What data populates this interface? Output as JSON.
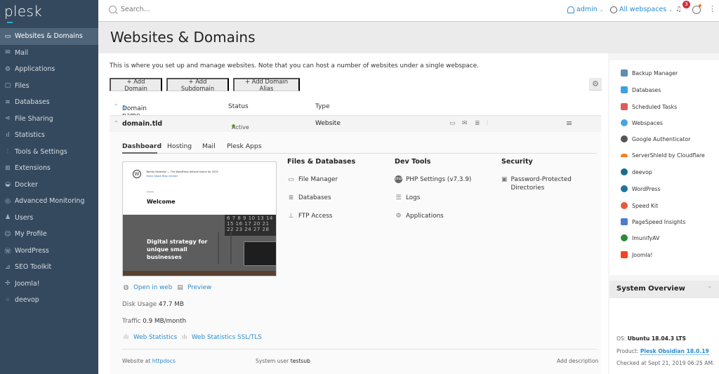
{
  "app": {
    "logo": "plesk"
  },
  "sidebar": {
    "items": [
      {
        "label": "Websites & Domains",
        "icon": "monitor-icon",
        "active": true
      },
      {
        "label": "Mail",
        "icon": "mail-icon"
      },
      {
        "label": "Applications",
        "icon": "gear-icon"
      },
      {
        "label": "Files",
        "icon": "folder-icon"
      },
      {
        "label": "Databases",
        "icon": "database-icon"
      },
      {
        "label": "File Sharing",
        "icon": "share-icon"
      },
      {
        "label": "Statistics",
        "icon": "bar-chart-icon"
      },
      {
        "label": "Tools & Settings",
        "icon": "sliders-icon"
      },
      {
        "label": "Extensions",
        "icon": "extensions-icon"
      },
      {
        "label": "Docker",
        "icon": "docker-icon"
      },
      {
        "label": "Advanced Monitoring",
        "icon": "monitoring-icon"
      },
      {
        "label": "Users",
        "icon": "user-icon"
      },
      {
        "label": "My Profile",
        "icon": "profile-icon"
      },
      {
        "label": "WordPress",
        "icon": "wordpress-icon"
      },
      {
        "label": "SEO Toolkit",
        "icon": "seo-icon"
      },
      {
        "label": "Joomla!",
        "icon": "joomla-icon"
      },
      {
        "label": "deevop",
        "icon": "deevop-icon"
      }
    ],
    "collapse_glyph": "‹"
  },
  "topbar": {
    "search_placeholder": "Search...",
    "user": "admin",
    "webspaces": "All webspaces",
    "notifications_count": "3",
    "chevron": "⌄"
  },
  "page": {
    "title": "Websites & Domains",
    "intro": "This is where you set up and manage websites. Note that you can host a number of websites under a single webspace.",
    "buttons": [
      "+ Add Domain",
      "+ Add Subdomain",
      "+ Add Domain Alias"
    ]
  },
  "table": {
    "headers": {
      "domain": "Domain name",
      "sort_arrow": "↑",
      "status": "Status",
      "type": "Type"
    },
    "row": {
      "domain": "domain.tld",
      "status": "Active",
      "type": "Website"
    }
  },
  "domain_panel": {
    "tabs": [
      "Dashboard",
      "Hosting",
      "Mail",
      "Plesk Apps"
    ],
    "active_tab": "Dashboard",
    "preview": {
      "site_title": "Twenty Nineteen — The WordPress default theme for 2019",
      "menu": "Home  About  Blog  Contact",
      "welcome": "Welcome",
      "hero": "Digital strategy for unique small businesses",
      "calendar": "6 7 8 9 10 13 14 15 16 17 20 21 22 23 24 27 28"
    },
    "columns": [
      {
        "title": "Files & Databases",
        "items": [
          {
            "label": "File Manager",
            "icon": "folder-icon"
          },
          {
            "label": "Databases",
            "icon": "database-icon"
          },
          {
            "label": "FTP Access",
            "icon": "ftp-icon"
          }
        ]
      },
      {
        "title": "Dev Tools",
        "items": [
          {
            "label": "PHP Settings (v7.3.9)",
            "icon": "php-icon"
          },
          {
            "label": "Logs",
            "icon": "list-icon"
          },
          {
            "label": "Applications",
            "icon": "gear-icon"
          }
        ]
      },
      {
        "title": "Security",
        "items": [
          {
            "label": "Password-Protected Directories",
            "icon": "protected-folder-icon"
          }
        ]
      }
    ],
    "open_in_web": "Open in web",
    "preview_link": "Preview",
    "disk_usage_label": "Disk Usage",
    "disk_usage_value": "47.7 MB",
    "traffic_label": "Traffic",
    "traffic_value": "0.9 MB/month",
    "web_stats": "Web Statistics",
    "web_stats_ssl": "Web Statistics SSL/TLS",
    "footer": {
      "website_at_label": "Website at",
      "website_at_value": "httpdocs",
      "system_user_label": "System user",
      "system_user_value": "testsub",
      "add_description": "Add description"
    }
  },
  "extensions": [
    {
      "label": "Backup Manager",
      "color": "#5a8fb0"
    },
    {
      "label": "Databases",
      "color": "#3fa0e0"
    },
    {
      "label": "Scheduled Tasks",
      "color": "#e05a5a"
    },
    {
      "label": "Webspaces",
      "color": "#4aa3df"
    },
    {
      "label": "Google Authenticator",
      "color": "#555555"
    },
    {
      "label": "ServerShield by Cloudflare",
      "color": "#f38020"
    },
    {
      "label": "deevop",
      "color": "#1b6e8a"
    },
    {
      "label": "WordPress",
      "color": "#21759b"
    },
    {
      "label": "Speed Kit",
      "color": "#e8583a"
    },
    {
      "label": "PageSpeed Insights",
      "color": "#4a7fd0"
    },
    {
      "label": "ImunifyAV",
      "color": "#2e8b3e"
    },
    {
      "label": "Joomla!",
      "color": "#f44321"
    }
  ],
  "system_overview": {
    "title": "System Overview",
    "os_label": "OS:",
    "os_value": "Ubuntu 18.04.3 LTS",
    "product_label": "Product:",
    "product_value": "Plesk Obsidian 18.0.19",
    "checked": "Checked at Sept 21, 2019 06:25 AM."
  },
  "colors": {
    "sidebar_bg": "#35495e",
    "accent": "#2a8bcf",
    "active_green": "#7cb342",
    "badge_red": "#d0303d"
  }
}
